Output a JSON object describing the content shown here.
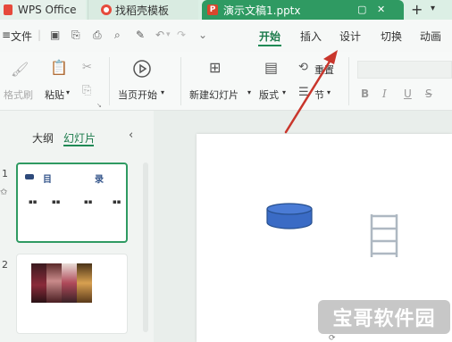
{
  "tabs": {
    "wps_office": "WPS Office",
    "template": "找稻壳模板",
    "document": "演示文稿1.pptx"
  },
  "menu": {
    "file": "文件",
    "ribbon_tabs": [
      "开始",
      "插入",
      "设计",
      "切换",
      "动画"
    ]
  },
  "ribbon": {
    "format_painter": "格式刷",
    "paste": "粘贴",
    "play_from_current": "当页开始",
    "new_slide": "新建幻灯片",
    "layout": "版式",
    "reset": "重置",
    "section": "节",
    "bold": "B",
    "italic": "I",
    "underline": "U",
    "strikethrough": "S"
  },
  "left_panel": {
    "outline_tab": "大纲",
    "slides_tab": "幻灯片",
    "slide1_number": "1",
    "slide2_number": "2",
    "slide1_title": "目",
    "slide1_title2": "录"
  },
  "watermark": "宝哥软件园",
  "colors": {
    "accent": "#1f8a55",
    "tab_active": "#2f9a62",
    "cylinder": "#3a6bc5"
  }
}
